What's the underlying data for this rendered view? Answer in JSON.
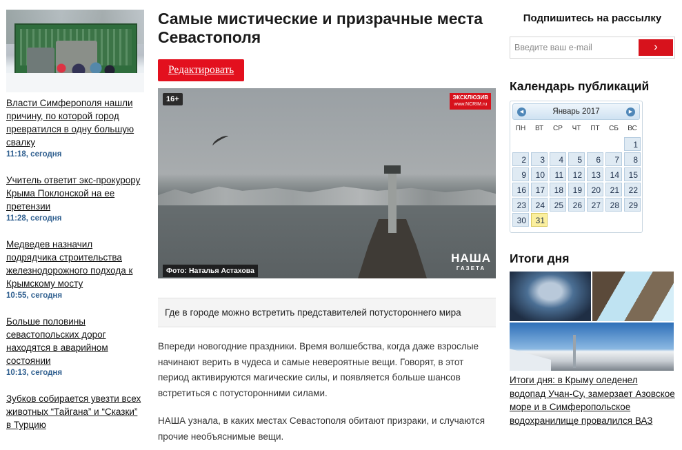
{
  "left_news": [
    {
      "title": "Власти Симферополя нашли причину, по которой город превратился в одну большую свалку",
      "time": "11:18, сегодня"
    },
    {
      "title": "Учитель ответит экс-прокурору Крыма Поклонской на ее претензии",
      "time": "11:28, сегодня"
    },
    {
      "title": "Медведев назначил подрядчика строительства железнодорожного подхода к Крымскому мосту",
      "time": "10:55, сегодня"
    },
    {
      "title": "Больше половины севастопольских дорог находятся в аварийном состоянии",
      "time": "10:13, сегодня"
    },
    {
      "title": "Зубков собирается увезти всех животных “Тайгана” и “Сказки” в Турцию",
      "time": ""
    }
  ],
  "article": {
    "title": "Самые мистические и призрачные места Севастополя",
    "edit_label": "Редактировать",
    "age_badge": "16+",
    "exclusive_badge": "ЭКСКЛЮЗИВ",
    "exclusive_site": "www.NCRIM.ru",
    "photo_credit": "Фото: Наталья Астахова",
    "logo_top": "НАША",
    "logo_bottom": "ГАЗЕТА",
    "lead": "Где в городе можно встретить представителей потустороннего мира",
    "paragraphs": [
      "Впереди новогодние праздники. Время волшебства, когда даже взрослые начинают верить в чудеса и самые невероятные вещи. Говорят, в этот период активируются магические силы, и появляется больше шансов встретиться с потусторонними силами.",
      "НАША узнала, в каких местах Севастополя обитают призраки, и случаются прочие необъяснимые вещи."
    ]
  },
  "subscribe": {
    "title": "Подпишитесь на рассылку",
    "placeholder": "Введите ваш e-mail",
    "button_icon": "chevron-right-icon",
    "button_glyph": "›"
  },
  "calendar": {
    "section_title": "Календарь публикаций",
    "month_label": "Январь  2017",
    "prev_glyph": "◀",
    "next_glyph": "▶",
    "weekdays": [
      "ПН",
      "ВТ",
      "СР",
      "ЧТ",
      "ПТ",
      "СБ",
      "ВС"
    ],
    "leading_blanks": 6,
    "days": [
      "1",
      "2",
      "3",
      "4",
      "5",
      "6",
      "7",
      "8",
      "9",
      "10",
      "11",
      "12",
      "13",
      "14",
      "15",
      "16",
      "17",
      "18",
      "19",
      "20",
      "21",
      "22",
      "23",
      "24",
      "25",
      "26",
      "27",
      "28",
      "29",
      "30",
      "31"
    ],
    "today": "31"
  },
  "results": {
    "section_title": "Итоги дня",
    "link": "Итоги дня: в Крыму оледенел водопад Учан-Су, замерзает Азовское море и в Симферопольское водохранилище провалился ВАЗ"
  },
  "colors": {
    "accent_red": "#e3101e",
    "time_blue": "#2f5f8f",
    "today_yellow": "#fbef9e"
  }
}
